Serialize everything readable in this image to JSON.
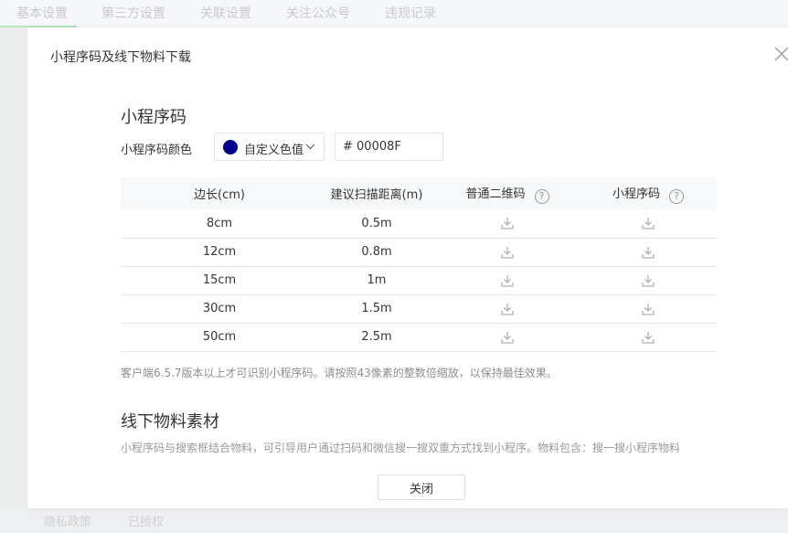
{
  "background": {
    "tabs": [
      "基本设置",
      "第三方设置",
      "关联设置",
      "关注公众号",
      "违规记录"
    ],
    "footer": [
      "隐私政策",
      "已授权"
    ]
  },
  "dialog": {
    "title": "小程序码及线下物料下载",
    "close_icon": "close-icon",
    "qr_section": {
      "title": "小程序码",
      "color_label": "小程序码颜色",
      "color_option": "自定义色值",
      "color_value": "# 00008F",
      "color_hex": "#00008F",
      "columns": [
        "边长(cm)",
        "建议扫描距离(m)",
        "普通二维码",
        "小程序码"
      ],
      "rows": [
        {
          "size": "8cm",
          "distance": "0.5m"
        },
        {
          "size": "12cm",
          "distance": "0.8m"
        },
        {
          "size": "15cm",
          "distance": "1m"
        },
        {
          "size": "30cm",
          "distance": "1.5m"
        },
        {
          "size": "50cm",
          "distance": "2.5m"
        }
      ],
      "note": "客户端6.5.7版本以上才可识别小程序码。请按照43像素的整数倍缩放，以保持最佳效果。"
    },
    "offline_section": {
      "title": "线下物料素材",
      "desc": "小程序码与搜索框结合物料，可引导用户通过扫码和微信搜一搜双重方式找到小程序。物料包含：搜一搜小程序物料"
    },
    "close_button": "关闭"
  }
}
